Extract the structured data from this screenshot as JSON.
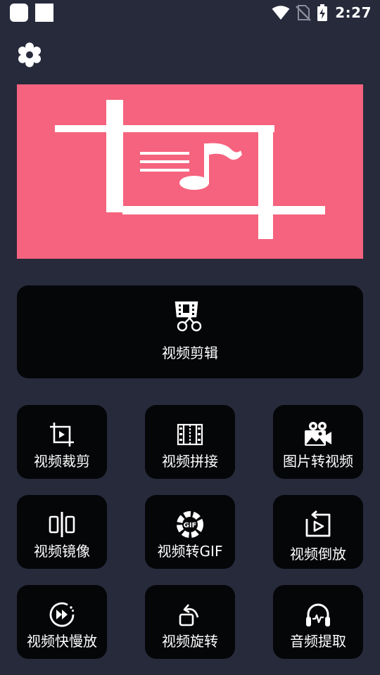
{
  "status_bar": {
    "time": "2:27"
  },
  "main_tool": {
    "label": "视频剪辑",
    "icon": "scissors-film-icon"
  },
  "tools": [
    {
      "label": "视频裁剪",
      "icon": "crop-icon"
    },
    {
      "label": "视频拼接",
      "icon": "film-strip-icon"
    },
    {
      "label": "图片转视频",
      "icon": "image-camera-icon"
    },
    {
      "label": "视频镜像",
      "icon": "mirror-icon"
    },
    {
      "label": "视频转GIF",
      "icon": "gif-icon"
    },
    {
      "label": "视频倒放",
      "icon": "reverse-play-icon"
    },
    {
      "label": "视频快慢放",
      "icon": "speed-icon"
    },
    {
      "label": "视频旋转",
      "icon": "rotate-icon"
    },
    {
      "label": "音频提取",
      "icon": "headphones-icon"
    }
  ],
  "colors": {
    "background": "#262a3b",
    "card": "#050608",
    "banner": "#f6637e"
  }
}
